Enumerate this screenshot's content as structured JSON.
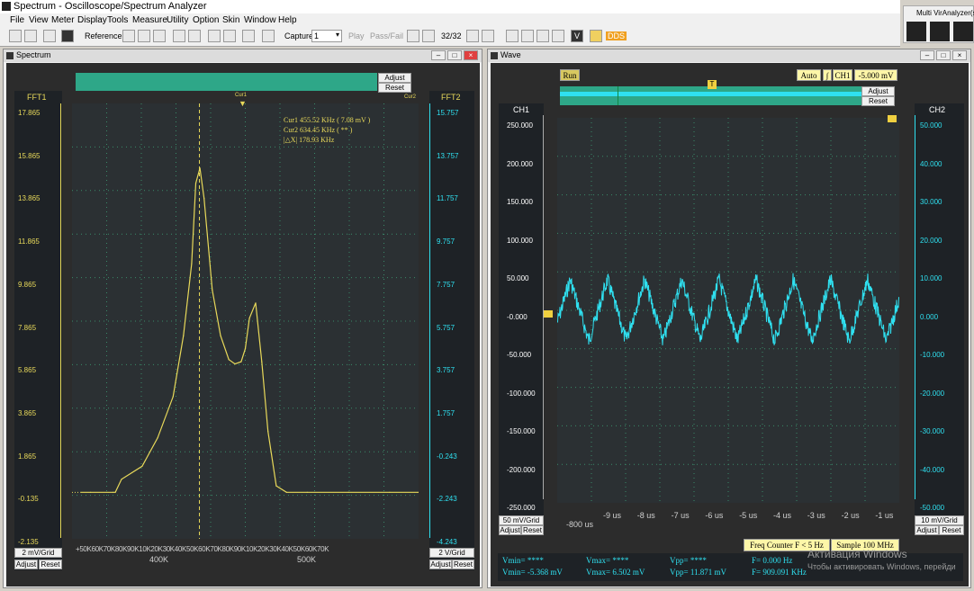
{
  "app": {
    "title": "Spectrum - Oscilloscope/Spectrum Analyzer",
    "multi_label": "Multi VirAnalyzer(s)"
  },
  "menu": [
    "File",
    "View",
    "Meter",
    "Display",
    "Tools",
    "Measure",
    "Utility",
    "Option",
    "Skin",
    "Window",
    "Help"
  ],
  "toolbar": {
    "reference": "Reference",
    "capture": "Capture",
    "capture_value": "1",
    "play": "Play",
    "pass_fail": "Pass/Fail",
    "frame": "32/32",
    "v": "V",
    "dds": "DDS"
  },
  "spectrum": {
    "title": "Spectrum",
    "adjust": "Adjust",
    "reset": "Reset",
    "ch_left": "FFT1",
    "ch_right": "FFT2",
    "left_ticks": [
      "17.865",
      "15.865",
      "13.865",
      "11.865",
      "9.865",
      "7.865",
      "5.865",
      "3.865",
      "1.865",
      "-0.135",
      "-2.135"
    ],
    "right_ticks": [
      "15.757",
      "13.757",
      "11.757",
      "9.757",
      "7.757",
      "5.757",
      "3.757",
      "1.757",
      "-0.243",
      "-2.243",
      "-4.243"
    ],
    "left_grid": "2 mV/Grid",
    "right_grid": "2 V/Grid",
    "x_ticks": "+50K60K70K80K90K10K20K30K40K50K60K70K80K90K10K20K30K40K50K60K70K",
    "x_major": [
      "400K",
      "500K"
    ],
    "cur1_tag": "Cur1",
    "cur2_tag": "Cur2",
    "readout": [
      "Cur1   455.52 KHz ( 7.08 mV )",
      "Cur2   634.45 KHz ( ** )",
      "|△X|   178.93 KHz"
    ],
    "colors": {
      "trace": "#e8d95a",
      "right_axis": "#2fe0f0",
      "grid": "#3a8a6a"
    }
  },
  "chart_data": {
    "type": "line",
    "title": "",
    "xlabel": "",
    "ylabel": "",
    "x": [
      350,
      372,
      374,
      380,
      400,
      415,
      430,
      440,
      448,
      452,
      456,
      460,
      468,
      476,
      484,
      490,
      496,
      500,
      504,
      510,
      516,
      522,
      530,
      540,
      560,
      600,
      640,
      668
    ],
    "series": [
      {
        "name": "FFT1",
        "values": [
          0,
          0,
          0,
          0.6,
          1.2,
          2.5,
          4.4,
          7.2,
          10.5,
          14.2,
          14.9,
          13.5,
          9.3,
          7.2,
          6.1,
          5.9,
          6.0,
          6.6,
          8.0,
          8.7,
          6.0,
          2.8,
          0.3,
          0,
          0,
          0,
          0,
          0
        ]
      }
    ],
    "ylim": [
      -2.135,
      17.865
    ]
  },
  "wave": {
    "title": "Wave",
    "run": "Run",
    "mode": "Auto",
    "trig_ch": "CH1",
    "trig_level": "-5.000 mV",
    "adjust": "Adjust",
    "reset": "Reset",
    "ch1": "CH1",
    "ch2": "CH2",
    "ch1_ticks": [
      "250.000",
      "200.000",
      "150.000",
      "100.000",
      "50.000",
      "-0.000",
      "-50.000",
      "-100.000",
      "-150.000",
      "-200.000",
      "-250.000"
    ],
    "ch2_ticks": [
      "50.000",
      "40.000",
      "30.000",
      "20.000",
      "10.000",
      "0.000",
      "-10.000",
      "-20.000",
      "-30.000",
      "-40.000",
      "-50.000"
    ],
    "ch1_grid": "50 mV/Grid",
    "ch2_grid": "10 mV/Grid",
    "t_start": "-800 us",
    "t_ticks": [
      "-9 us",
      "-8 us",
      "-7 us",
      "-6 us",
      "-5 us",
      "-4 us",
      "-3 us",
      "-2 us",
      "-1 us"
    ],
    "freq_counter": "Freq Counter F < 5 Hz",
    "sample": "Sample 100 MHz",
    "measure": {
      "vmin1": "Vmin= ****",
      "vmin2": "Vmin= -5.368 mV",
      "vmax1": "Vmax= ****",
      "vmax2": "Vmax= 6.502 mV",
      "vpp1": "Vpp= ****",
      "vpp2": "Vpp= 11.871 mV",
      "f1": "F= 0.000 Hz",
      "f2": "F= 909.091 KHz"
    },
    "colors": {
      "trace": "#2fe0f0"
    }
  },
  "watermark": {
    "line1": "Активация Windows",
    "line2": "Чтобы активировать Windows, перейди"
  }
}
